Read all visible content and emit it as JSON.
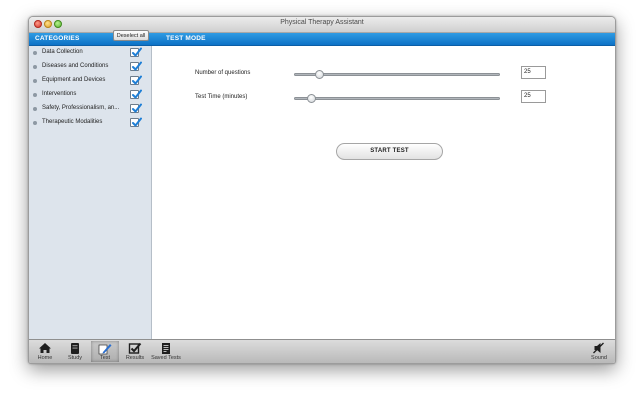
{
  "window": {
    "title": "Physical Therapy Assistant"
  },
  "sidebar": {
    "header": "CATEGORIES",
    "deselect_label": "Deselect all",
    "items": [
      {
        "label": "Data Collection",
        "checked": true
      },
      {
        "label": "Diseases and Conditions",
        "checked": true
      },
      {
        "label": "Equipment and Devices",
        "checked": true
      },
      {
        "label": "Interventions",
        "checked": true
      },
      {
        "label": "Safety, Professionalism, an...",
        "checked": true
      },
      {
        "label": "Therapeutic Modalities",
        "checked": true
      }
    ]
  },
  "main": {
    "header": "TEST MODE",
    "questions": {
      "label": "Number of questions",
      "value": "25",
      "slider_fraction": 0.1
    },
    "time": {
      "label": "Test Time (minutes)",
      "value": "25",
      "slider_fraction": 0.06
    },
    "start_label": "START TEST"
  },
  "toolbar": {
    "items": [
      {
        "label": "Home",
        "icon": "home-icon"
      },
      {
        "label": "Study",
        "icon": "book-icon"
      },
      {
        "label": "Test",
        "icon": "pencil-icon",
        "active": true
      },
      {
        "label": "Results",
        "icon": "checkmark-icon"
      },
      {
        "label": "Saved Tests",
        "icon": "document-icon"
      }
    ],
    "sound_label": "Sound"
  },
  "colors": {
    "accent": "#1a83d4",
    "sidebar_bg": "#dde4ec",
    "check": "#1f7fd6"
  }
}
